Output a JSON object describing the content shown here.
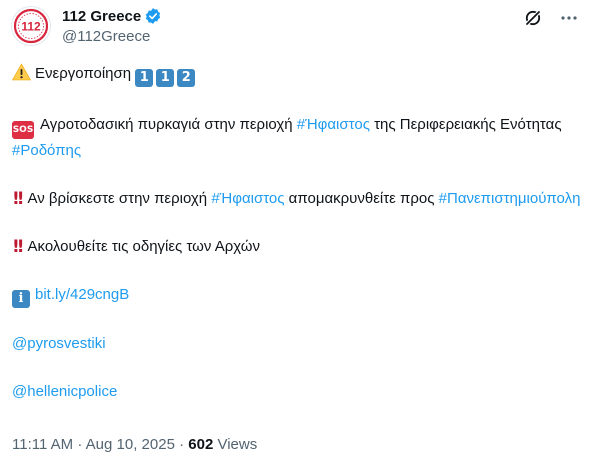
{
  "account": {
    "display_name": "112 Greece",
    "handle": "@112Greece",
    "avatar_text": "112",
    "verified": true
  },
  "tweet": {
    "line1_text": "Ενεργοποίηση",
    "line1_keys": [
      "1",
      "1",
      "2"
    ],
    "p2_a": "Αγροτοδασική πυρκαγιά στην περιοχή ",
    "p2_hash1": "#Ήφαιστος",
    "p2_b": " της Περιφερειακής Ενότητας ",
    "p2_hash2": "#Ροδόπης",
    "p3_a": "Αν βρίσκεστε στην περιοχή ",
    "p3_hash1": "#Ήφαιστος",
    "p3_b": " απομακρυνθείτε προς ",
    "p3_hash2": "#Πανεπιστημιούπολη",
    "p4_text": "Ακολουθείτε τις οδηγίες των Αρχών",
    "link": "bit.ly/429cngB",
    "mention1": "@pyrosvestiki",
    "mention2": "@hellenicpolice"
  },
  "meta": {
    "time": "11:11 AM",
    "date": "Aug 10, 2025",
    "separator": " · ",
    "views_count": "602",
    "views_label": " Views"
  },
  "icons": {
    "verified": "verified-badge-icon",
    "grok": "grok-icon",
    "more": "more-options-icon",
    "warning": "warning-emoji-icon",
    "sos": "sos-emoji-icon",
    "bangbang": "double-exclamation-emoji-icon",
    "info": "information-emoji-icon"
  },
  "colors": {
    "accent": "#1d9bf0",
    "keycap": "#3b88c3",
    "sos": "#dd2e44",
    "bang": "#be1931",
    "avatar_red": "#d7263d"
  }
}
